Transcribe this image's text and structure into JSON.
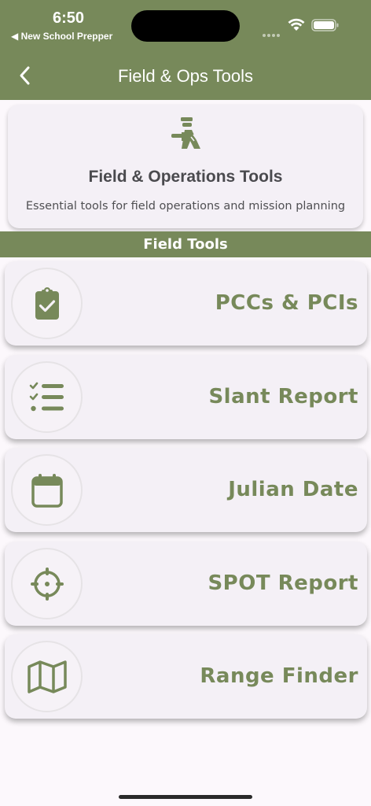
{
  "status_bar": {
    "time": "6:50",
    "back_app": "◀ New School Prepper"
  },
  "nav": {
    "title": "Field & Ops Tools",
    "back_icon": "chevron-left-icon"
  },
  "intro": {
    "icon": "guard-icon",
    "title": "Field & Operations Tools",
    "subtitle": "Essential tools for field operations and mission planning"
  },
  "section": {
    "title": "Field Tools"
  },
  "tools": [
    {
      "label": "PCCs & PCIs",
      "icon": "clipboard-check-icon"
    },
    {
      "label": "Slant Report",
      "icon": "checklist-icon"
    },
    {
      "label": "Julian Date",
      "icon": "calendar-icon"
    },
    {
      "label": "SPOT Report",
      "icon": "crosshair-icon"
    },
    {
      "label": "Range Finder",
      "icon": "map-icon"
    }
  ],
  "colors": {
    "accent": "#77895a",
    "card": "#f4f0f6",
    "background": "#fcf8fc"
  }
}
